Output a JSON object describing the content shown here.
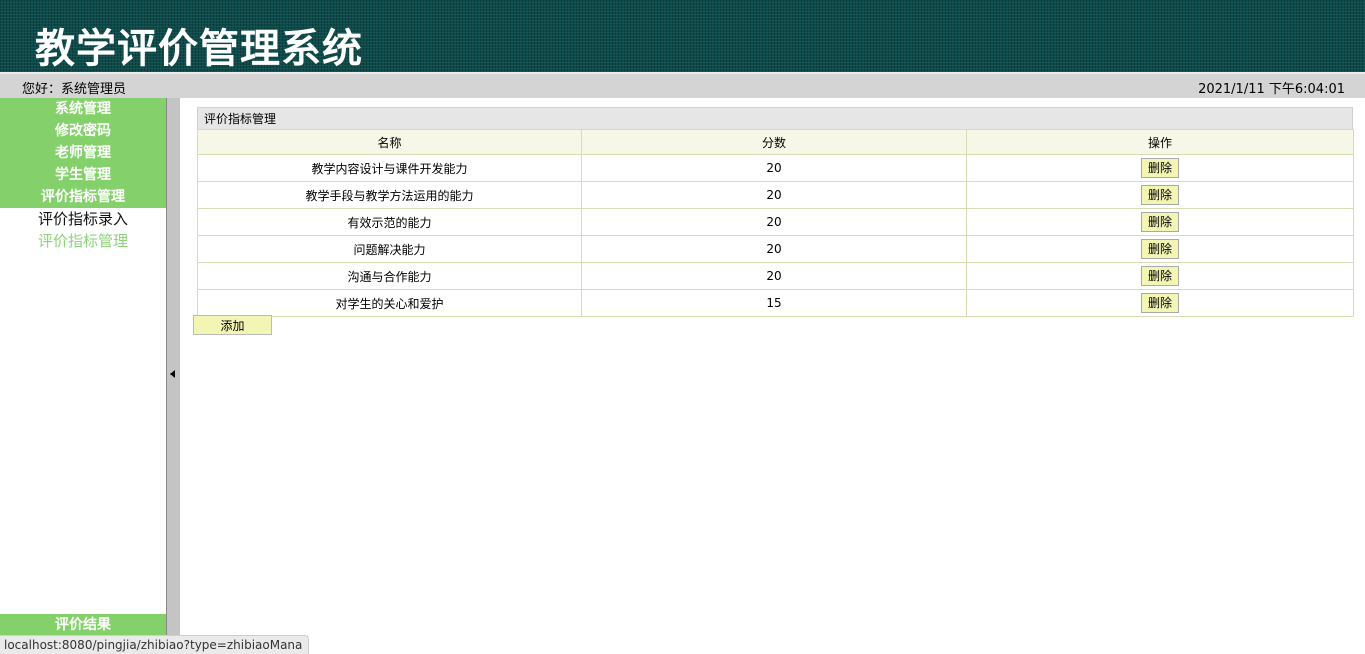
{
  "header": {
    "title": "教学评价管理系统"
  },
  "topbar": {
    "greeting": "您好：系统管理员",
    "datetime": "2021/1/11 下午6:04:01"
  },
  "sidebar": {
    "menu": [
      "系统管理",
      "修改密码",
      "老师管理",
      "学生管理",
      "评价指标管理"
    ],
    "submenu": [
      "评价指标录入",
      "评价指标管理"
    ],
    "bottom": "评价结果"
  },
  "panel": {
    "title": "评价指标管理",
    "columns": [
      "名称",
      "分数",
      "操作"
    ],
    "rows": [
      {
        "name": "教学内容设计与课件开发能力",
        "score": "20",
        "action": "删除"
      },
      {
        "name": "教学手段与教学方法运用的能力",
        "score": "20",
        "action": "删除"
      },
      {
        "name": "有效示范的能力",
        "score": "20",
        "action": "删除"
      },
      {
        "name": "问题解决能力",
        "score": "20",
        "action": "删除"
      },
      {
        "name": "沟通与合作能力",
        "score": "20",
        "action": "删除"
      },
      {
        "name": "对学生的关心和爱护",
        "score": "15",
        "action": "删除"
      }
    ],
    "add_label": "添加"
  },
  "statusbar": {
    "url": "localhost:8080/pingjia/zhibiao?type=zhibiaoMana"
  },
  "colors": {
    "header_bg": "#0d4a4a",
    "menu_green": "#84d16b",
    "active_green": "#8ed37a",
    "button_yellow": "#f2f5b3"
  }
}
